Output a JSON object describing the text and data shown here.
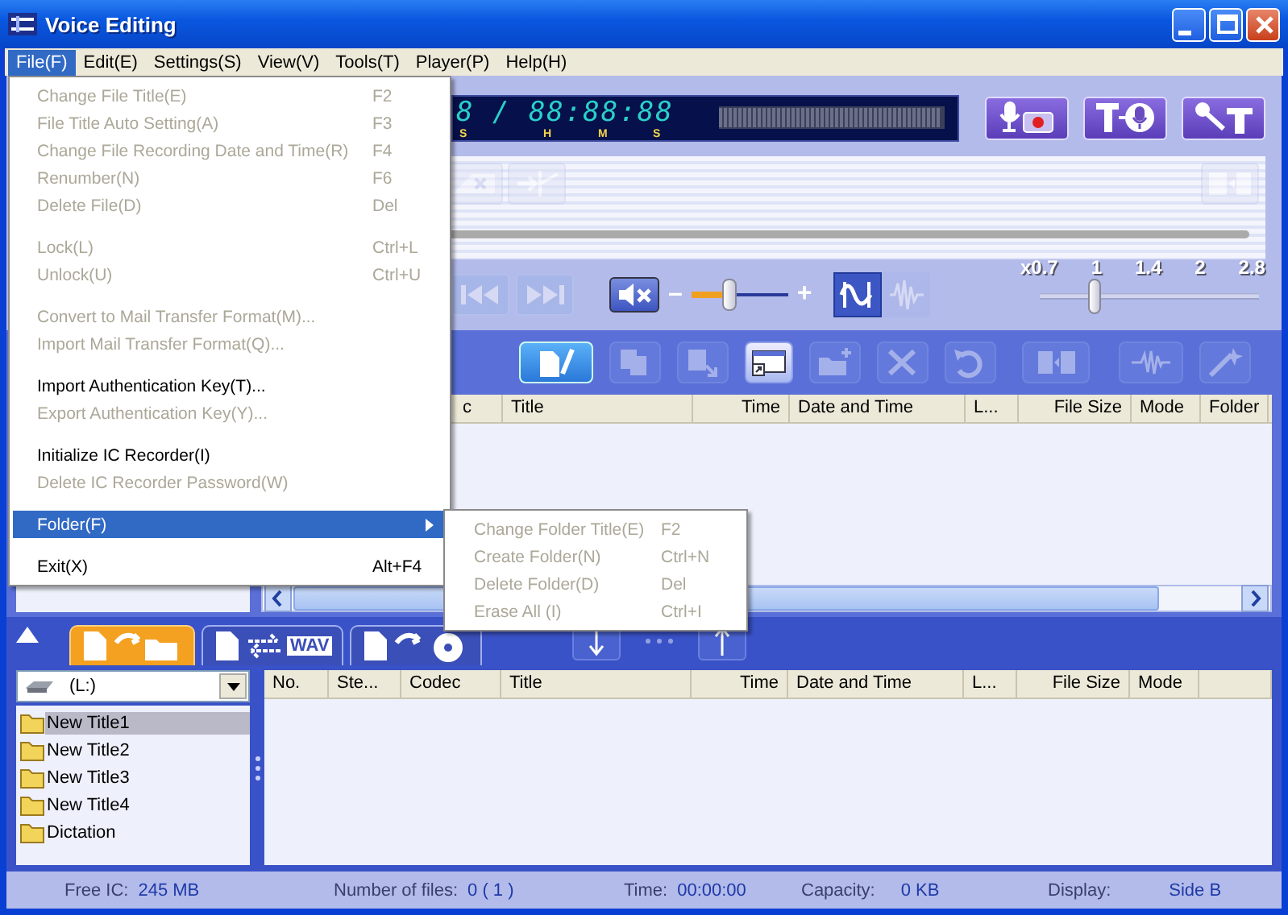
{
  "window": {
    "title": "Voice Editing"
  },
  "menubar": [
    {
      "label": "File(F)",
      "selected": true
    },
    {
      "label": "Edit(E)",
      "selected": false
    },
    {
      "label": "Settings(S)",
      "selected": false
    },
    {
      "label": "View(V)",
      "selected": false
    },
    {
      "label": "Tools(T)",
      "selected": false
    },
    {
      "label": "Player(P)",
      "selected": false
    },
    {
      "label": "Help(H)",
      "selected": false
    }
  ],
  "file_menu": [
    {
      "kind": "item",
      "label": "Change File Title(E)",
      "shortcut": "F2",
      "disabled": true,
      "selected": false
    },
    {
      "kind": "item",
      "label": "File Title Auto Setting(A)",
      "shortcut": "F3",
      "disabled": true,
      "selected": false
    },
    {
      "kind": "item",
      "label": "Change File Recording Date and Time(R)",
      "shortcut": "F4",
      "disabled": true,
      "selected": false
    },
    {
      "kind": "item",
      "label": "Renumber(N)",
      "shortcut": "F6",
      "disabled": true,
      "selected": false
    },
    {
      "kind": "item",
      "label": "Delete File(D)",
      "shortcut": "Del",
      "disabled": true,
      "selected": false
    },
    {
      "kind": "separator"
    },
    {
      "kind": "item",
      "label": "Lock(L)",
      "shortcut": "Ctrl+L",
      "disabled": true,
      "selected": false
    },
    {
      "kind": "item",
      "label": "Unlock(U)",
      "shortcut": "Ctrl+U",
      "disabled": true,
      "selected": false
    },
    {
      "kind": "separator"
    },
    {
      "kind": "item",
      "label": "Convert to Mail Transfer Format(M)...",
      "disabled": true,
      "selected": false
    },
    {
      "kind": "item",
      "label": "Import Mail Transfer Format(Q)...",
      "disabled": true,
      "selected": false
    },
    {
      "kind": "separator"
    },
    {
      "kind": "item",
      "label": "Import Authentication Key(T)...",
      "disabled": false,
      "selected": false
    },
    {
      "kind": "item",
      "label": "Export Authentication Key(Y)...",
      "disabled": true,
      "selected": false
    },
    {
      "kind": "separator"
    },
    {
      "kind": "item",
      "label": "Initialize IC Recorder(I)",
      "disabled": false,
      "selected": false
    },
    {
      "kind": "item",
      "label": "Delete IC Recorder Password(W)",
      "disabled": true,
      "selected": false
    },
    {
      "kind": "separator"
    },
    {
      "kind": "item",
      "label": "Folder(F)",
      "disabled": false,
      "selected": true,
      "submenu": true
    },
    {
      "kind": "separator"
    },
    {
      "kind": "item",
      "label": "Exit(X)",
      "shortcut": "Alt+F4",
      "disabled": false,
      "selected": false
    }
  ],
  "folder_submenu": [
    {
      "label": "Change Folder Title(E)",
      "shortcut": "F2",
      "disabled": true
    },
    {
      "label": "Create Folder(N)",
      "shortcut": "Ctrl+N",
      "disabled": true
    },
    {
      "label": "Delete Folder(D)",
      "shortcut": "Del",
      "disabled": true
    },
    {
      "label": "Erase All (I)",
      "shortcut": "Ctrl+I",
      "disabled": true
    }
  ],
  "display": {
    "counter": "8 / 88:88:88",
    "units": [
      "S",
      "H",
      "M",
      "S"
    ]
  },
  "record_buttons": [
    {
      "kind": "record"
    },
    {
      "kind": "text-to-voice"
    },
    {
      "kind": "voice-to-text"
    }
  ],
  "edit_tools": [
    {
      "kind": "delete-mark",
      "disabled": true
    },
    {
      "kind": "insert-mark",
      "disabled": true
    },
    {
      "kind": "split",
      "disabled": true
    }
  ],
  "playback": {
    "buttons": [
      {
        "kind": "previous",
        "disabled": true
      },
      {
        "kind": "next",
        "disabled": true
      }
    ],
    "volume": {
      "minus": "–",
      "plus": "+",
      "level": 0.4
    },
    "filters": [
      {
        "kind": "noise-cut",
        "selected": true,
        "disabled": false
      },
      {
        "kind": "voice-filter",
        "selected": false,
        "disabled": true
      }
    ],
    "speed": {
      "labels": [
        "x0.7",
        "1",
        "1.4",
        "2",
        "2.8"
      ],
      "level": 0.25
    }
  },
  "file_toolbar": [
    {
      "kind": "edit",
      "disabled": false
    },
    {
      "kind": "copy",
      "disabled": true
    },
    {
      "kind": "move",
      "disabled": true
    },
    {
      "kind": "properties",
      "disabled": false
    },
    {
      "kind": "new-folder",
      "disabled": true
    },
    {
      "kind": "delete",
      "disabled": true
    },
    {
      "kind": "undo",
      "disabled": true
    },
    {
      "kind": "split",
      "disabled": true
    },
    {
      "kind": "wave",
      "disabled": true
    },
    {
      "kind": "wand",
      "disabled": true
    }
  ],
  "upper_table": {
    "columns": [
      {
        "label": "c"
      },
      {
        "label": "Title"
      },
      {
        "label": "Time",
        "numeric": true
      },
      {
        "label": "Date and Time"
      },
      {
        "label": "L..."
      },
      {
        "label": "File Size",
        "numeric": true
      },
      {
        "label": "Mode"
      },
      {
        "label": "Folder"
      }
    ]
  },
  "transfer_tabs": [
    {
      "kind": "to-folder",
      "selected": true
    },
    {
      "kind": "convert",
      "label": "WAV",
      "selected": false
    },
    {
      "kind": "to-disc",
      "selected": false
    }
  ],
  "transfer_arrows": [
    {
      "kind": "down",
      "disabled": false
    },
    {
      "kind": "dots",
      "disabled": true
    },
    {
      "kind": "up",
      "disabled": false
    }
  ],
  "drive": {
    "value": "(L:)"
  },
  "folders": [
    {
      "label": "New Title1",
      "selected": true
    },
    {
      "label": "New Title2",
      "selected": false
    },
    {
      "label": "New Title3",
      "selected": false
    },
    {
      "label": "New Title4",
      "selected": false
    },
    {
      "label": "Dictation",
      "selected": false
    }
  ],
  "lower_table": {
    "columns": [
      {
        "label": "No."
      },
      {
        "label": "Ste..."
      },
      {
        "label": "Codec"
      },
      {
        "label": "Title"
      },
      {
        "label": "Time",
        "numeric": true
      },
      {
        "label": "Date and Time"
      },
      {
        "label": "L..."
      },
      {
        "label": "File Size",
        "numeric": true
      },
      {
        "label": "Mode"
      }
    ]
  },
  "status_bar": [
    {
      "label": "Free IC:",
      "value": "245 MB"
    },
    {
      "label": "Number of files:",
      "value": "0 ( 1 )"
    },
    {
      "label": "Time:",
      "value": "00:00:00"
    },
    {
      "label": "Capacity:",
      "value": "0 KB"
    },
    {
      "label": "Display:",
      "value": "Side B"
    }
  ]
}
